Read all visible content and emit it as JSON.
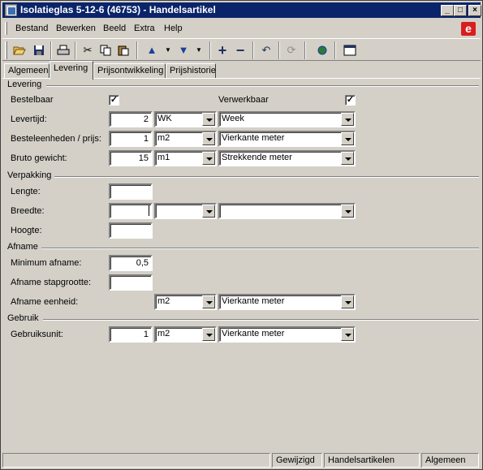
{
  "window": {
    "title": "Isolatieglas 5-12-6 (46753) - Handelsartikel"
  },
  "menu": [
    "Bestand",
    "Bewerken",
    "Beeld",
    "Extra",
    "Help"
  ],
  "tabs": [
    "Algemeen",
    "Levering",
    "Prijsontwikkeling",
    "Prijshistorie"
  ],
  "active_tab": "Levering",
  "sections": {
    "levering": "Levering",
    "verpakking": "Verpakking",
    "afname": "Afname",
    "gebruik": "Gebruik"
  },
  "levering": {
    "bestelbaar_label": "Bestelbaar",
    "bestelbaar_checked": true,
    "verwerkbaar_label": "Verwerkbaar",
    "verwerkbaar_checked": true,
    "levertijd_label": "Levertijd:",
    "levertijd_value": "2",
    "levertijd_unit": "WK",
    "levertijd_desc": "Week",
    "besteleenheden_label": "Besteleenheden / prijs:",
    "besteleenheden_value": "1",
    "besteleenheden_unit": "m2",
    "besteleenheden_desc": "Vierkante meter",
    "bruto_label": "Bruto gewicht:",
    "bruto_value": "15",
    "bruto_unit": "m1",
    "bruto_desc": "Strekkende meter"
  },
  "verpakking": {
    "lengte_label": "Lengte:",
    "breedte_label": "Breedte:",
    "hoogte_label": "Hoogte:"
  },
  "afname": {
    "minimum_label": "Minimum afname:",
    "minimum_value": "0,5",
    "stapgrootte_label": "Afname stapgrootte:",
    "eenheid_label": "Afname eenheid:",
    "eenheid_unit": "m2",
    "eenheid_desc": "Vierkante meter"
  },
  "gebruik": {
    "gebruiksunit_label": "Gebruiksunit:",
    "gebruiksunit_value": "1",
    "gebruiksunit_unit": "m2",
    "gebruiksunit_desc": "Vierkante meter"
  },
  "statusbar": [
    "Gewijzigd",
    "Handelsartikelen",
    "Algemeen"
  ],
  "icons": [
    "open-folder-icon",
    "save-icon",
    "print-icon",
    "cut-icon",
    "copy-icon",
    "paste-icon",
    "arrow-up-icon",
    "arrow-down-icon",
    "add-icon",
    "remove-icon",
    "undo-icon",
    "refresh-icon",
    "globe-icon",
    "window-icon"
  ]
}
